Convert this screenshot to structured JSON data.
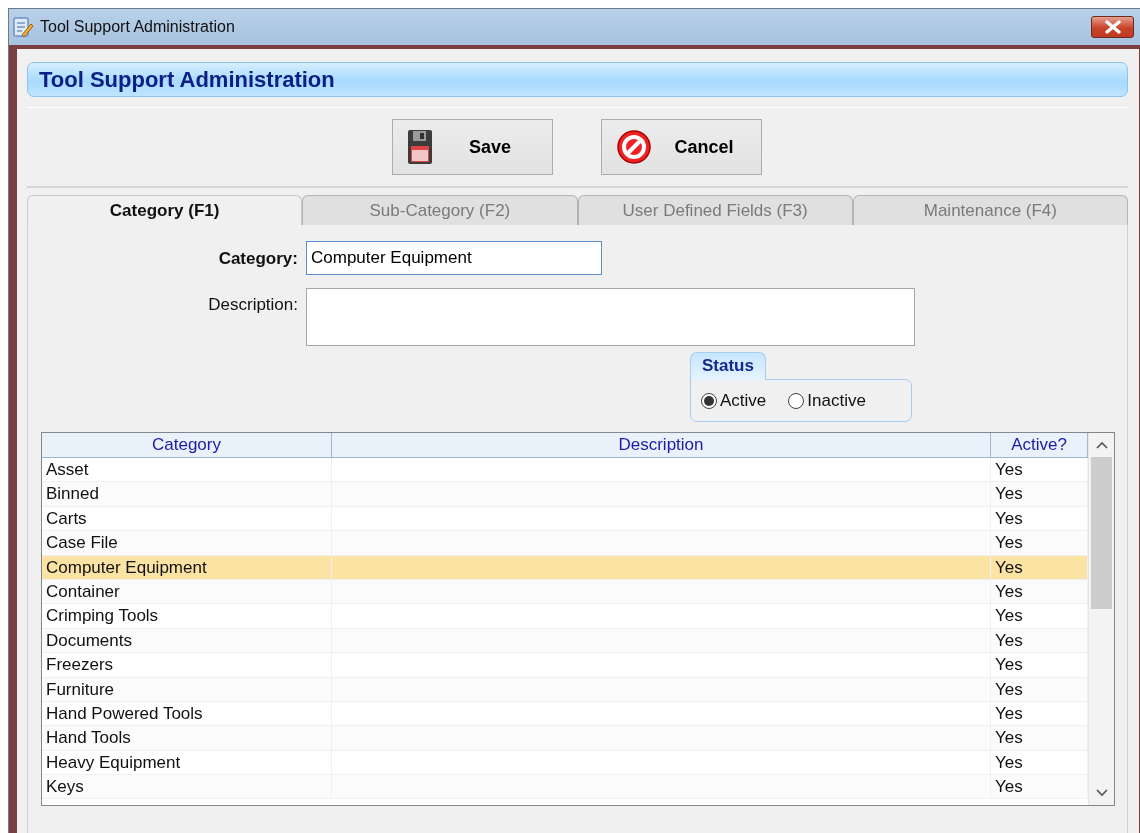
{
  "window": {
    "title": "Tool Support Administration"
  },
  "header": "Tool Support Administration",
  "buttons": [
    {
      "label": "Save",
      "kind": "save"
    },
    {
      "label": "Cancel",
      "kind": "cancel"
    }
  ],
  "tabs": [
    {
      "label": "Category (F1)",
      "selected": true
    },
    {
      "label": "Sub-Category (F2)",
      "selected": false
    },
    {
      "label": "User Defined Fields (F3)",
      "selected": false
    },
    {
      "label": "Maintenance (F4)",
      "selected": false
    }
  ],
  "form": {
    "category": {
      "label": "Category:",
      "value": "Computer Equipment"
    },
    "description": {
      "label": "Description:"
    }
  },
  "status": {
    "title": "Status",
    "options": [
      {
        "label": "Active",
        "selected": true
      },
      {
        "label": "Inactive",
        "selected": false
      }
    ]
  },
  "table": {
    "columns": [
      "Category",
      "Description",
      "Active?"
    ],
    "rows": [
      {
        "category": "Asset",
        "active": "Yes",
        "selected": false
      },
      {
        "category": "Binned",
        "active": "Yes",
        "selected": false
      },
      {
        "category": "Carts",
        "active": "Yes",
        "selected": false
      },
      {
        "category": "Case File",
        "active": "Yes",
        "selected": false
      },
      {
        "category": "Computer Equipment",
        "active": "Yes",
        "selected": true
      },
      {
        "category": "Container",
        "active": "Yes",
        "selected": false
      },
      {
        "category": "Crimping Tools",
        "active": "Yes",
        "selected": false
      },
      {
        "category": "Documents",
        "active": "Yes",
        "selected": false
      },
      {
        "category": "Freezers",
        "active": "Yes",
        "selected": false
      },
      {
        "category": "Furniture",
        "active": "Yes",
        "selected": false
      },
      {
        "category": "Hand Powered Tools",
        "active": "Yes",
        "selected": false
      },
      {
        "category": "Hand Tools",
        "active": "Yes",
        "selected": false
      },
      {
        "category": "Heavy Equipment",
        "active": "Yes",
        "selected": false
      },
      {
        "category": "Keys",
        "active": "Yes",
        "selected": false
      }
    ]
  }
}
